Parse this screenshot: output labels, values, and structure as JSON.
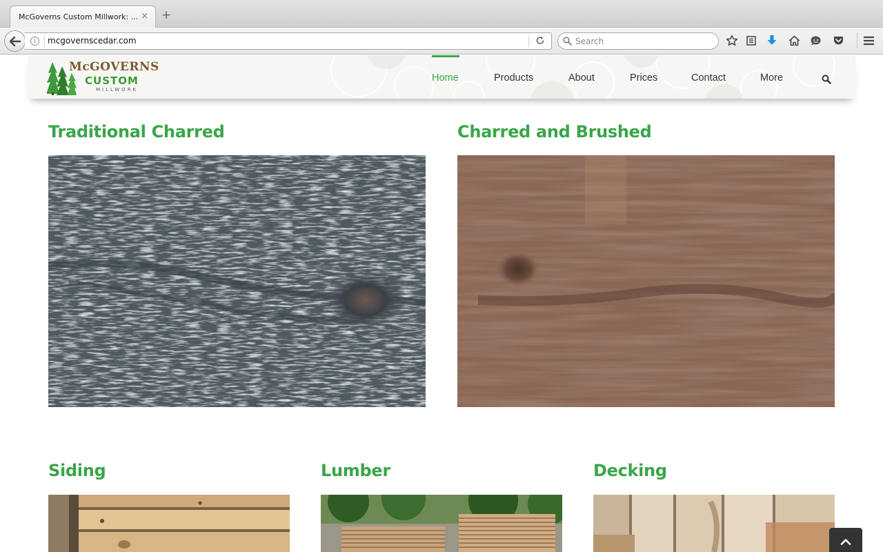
{
  "browser": {
    "tab_title": "McGoverns Custom Millwork: ...",
    "tab_close": "×",
    "new_tab": "+",
    "url": "mcgovernscedar.com",
    "search_placeholder": "Search"
  },
  "site": {
    "logo": {
      "line1": "McGOVERNS",
      "line2": "CUSTOM",
      "line3": "MILLWORK"
    },
    "menu": [
      {
        "label": "Home",
        "active": true
      },
      {
        "label": "Products",
        "active": false
      },
      {
        "label": "About",
        "active": false
      },
      {
        "label": "Prices",
        "active": false
      },
      {
        "label": "Contact",
        "active": false
      },
      {
        "label": "More",
        "active": false
      }
    ]
  },
  "sections": {
    "traditional_charred": "Traditional Charred",
    "charred_brushed": "Charred and Brushed",
    "siding": "Siding",
    "lumber": "Lumber",
    "decking": "Decking"
  },
  "colors": {
    "brand_green": "#3aa549",
    "logo_brown": "#7a5a2c",
    "char_gray": "#4f5a60",
    "brushed_brown": "#8a6654"
  },
  "icons": [
    "back-arrow-icon",
    "info-icon",
    "reload-icon",
    "search-icon",
    "star-icon",
    "reading-list-icon",
    "download-icon",
    "home-icon",
    "chat-icon",
    "pocket-icon",
    "hamburger-menu-icon",
    "chevron-up-icon"
  ]
}
